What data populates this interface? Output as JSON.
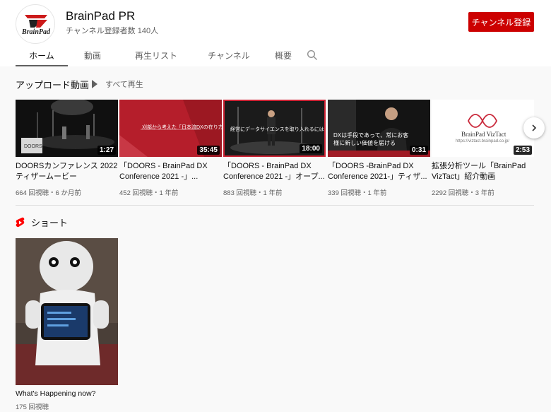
{
  "channel": {
    "name": "BrainPad PR",
    "subscribers": "チャンネル登録者数 140人",
    "subscribe_label": "チャンネル登録",
    "logo_text": "BrainPad"
  },
  "tabs": [
    {
      "label": "ホーム",
      "active": true
    },
    {
      "label": "動画"
    },
    {
      "label": "再生リスト"
    },
    {
      "label": "チャンネル"
    },
    {
      "label": "概要"
    }
  ],
  "uploads": {
    "title": "アップロード動画",
    "play_all": "すべて再生",
    "videos": [
      {
        "title": "DOORSカンファレンス 2022 ティザームービー",
        "meta": "664 回視聴・6 か月前",
        "duration": "1:27"
      },
      {
        "title": "「DOORS - BrainPad DX Conference 2021 -」...",
        "meta": "452 回視聴・1 年前",
        "duration": "35:45",
        "thumb_text": "刈部から考えた「日本流DXの在り方」"
      },
      {
        "title": "「DOORS - BrainPad DX Conference 2021 -」オープ...",
        "meta": "883 回視聴・1 年前",
        "duration": "18:00",
        "thumb_text": "経営にデータサイエンスを取り入れるには"
      },
      {
        "title": "「DOORS -BrainPad DX Conference 2021-」ティザ...",
        "meta": "339 回視聴・1 年前",
        "duration": "0:31",
        "thumb_text": "DXは手段であって、常にお客様に新しい価値を届ける"
      },
      {
        "title": "拡張分析ツール「BrainPad VizTact」紹介動画",
        "meta": "2292 回視聴・3 年前",
        "duration": "2:53",
        "thumb_text": "BrainPad VizTact",
        "thumb_url": "https://viztact.brainpad.co.jp/"
      }
    ]
  },
  "shorts": {
    "title": "ショート",
    "items": [
      {
        "title": "What's Happening now?",
        "meta": "175 回視聴"
      }
    ]
  },
  "colors": {
    "accent": "#cc0000",
    "text": "#0f0f0f",
    "secondary": "#606060",
    "bg": "#f9f9f9"
  }
}
